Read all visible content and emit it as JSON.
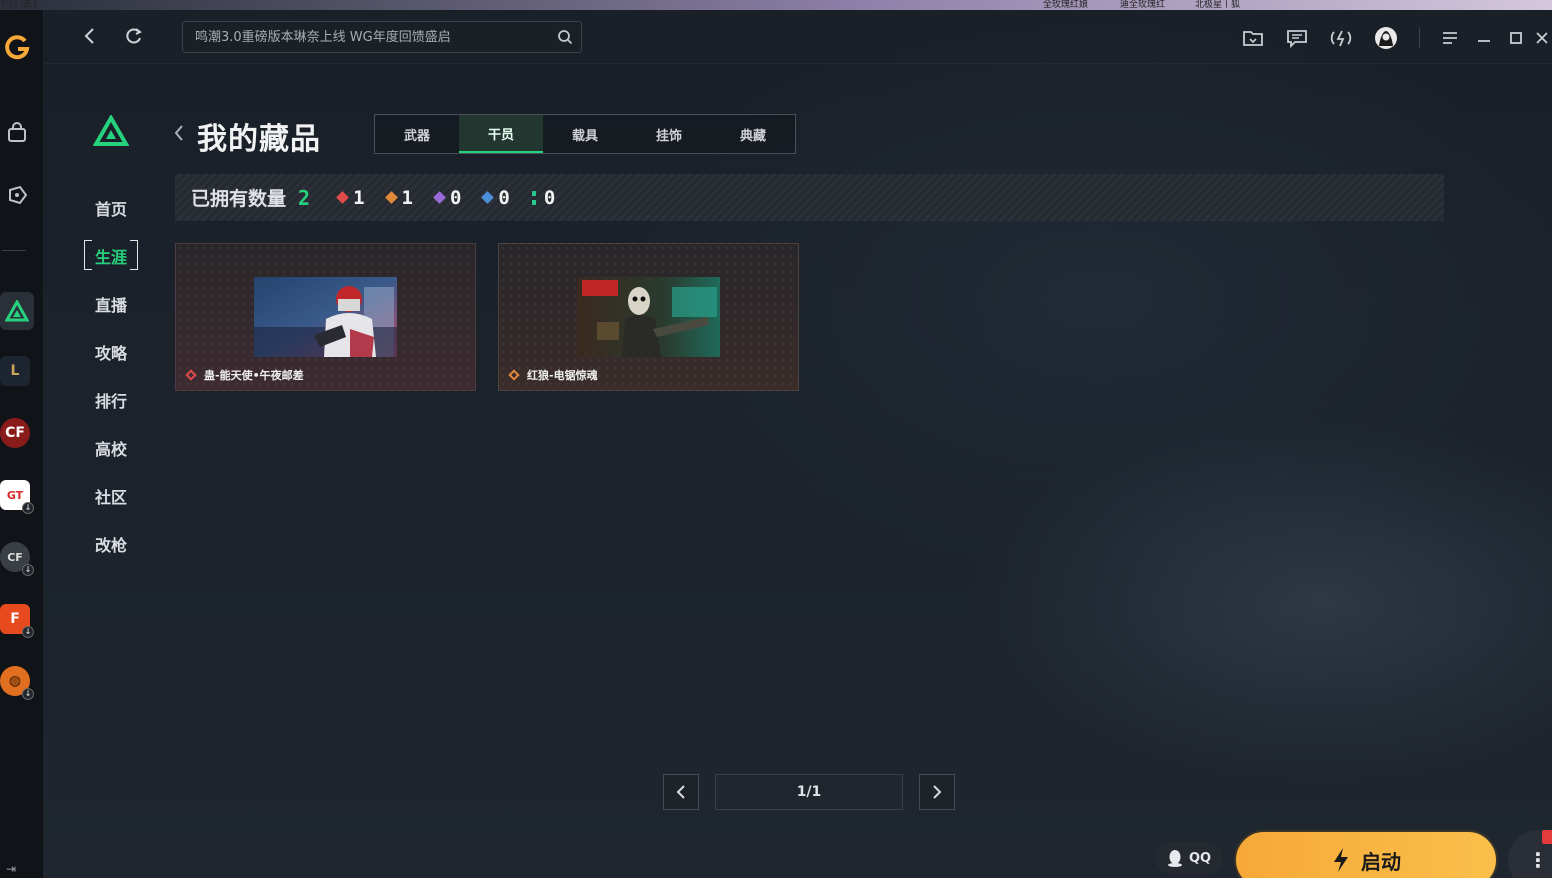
{
  "os_strip": {
    "texts": [
      "ドl丨l去1",
      "全玫瑰红娘",
      "迪全玫瑰红",
      "北极星丨狐"
    ]
  },
  "topbar": {
    "search_placeholder": "鸣潮3.0重磅版本琳奈上线 WG年度回馈盛启",
    "icons": [
      "back-icon",
      "refresh-icon",
      "search-icon",
      "folder-icon",
      "chat-icon",
      "speed-icon",
      "avatar-icon",
      "menu-icon",
      "minimize-icon",
      "maximize-icon",
      "close-icon"
    ]
  },
  "brand": {
    "color": "#27d27f"
  },
  "nav": {
    "items": [
      {
        "label": "首页"
      },
      {
        "label": "生涯"
      },
      {
        "label": "直播"
      },
      {
        "label": "攻略"
      },
      {
        "label": "排行"
      },
      {
        "label": "高校"
      },
      {
        "label": "社区"
      },
      {
        "label": "改枪"
      }
    ],
    "active_index": 1
  },
  "page": {
    "title": "我的藏品"
  },
  "tabs": {
    "items": [
      "武器",
      "干员",
      "载具",
      "挂饰",
      "典藏"
    ],
    "active_index": 1
  },
  "stats": {
    "label": "已拥有数量",
    "total": "2",
    "rarities": [
      {
        "color": "#e24b4b",
        "count": "1"
      },
      {
        "color": "#e28a3b",
        "count": "1"
      },
      {
        "color": "#9a6bd8",
        "count": "0"
      },
      {
        "color": "#4a8fd8",
        "count": "0"
      },
      {
        "color": "#27c890",
        "count": "0"
      }
    ]
  },
  "cards": [
    {
      "name": "蛊-能天使•午夜邮差",
      "rarity_color": "#e24b4b"
    },
    {
      "name": "红狼-电锯惊魂",
      "rarity_color": "#e28a3b"
    }
  ],
  "pager": {
    "current": "1/1"
  },
  "bottom": {
    "qq_label": "QQ",
    "launch_label": "启动",
    "accent": "#f6a838"
  }
}
